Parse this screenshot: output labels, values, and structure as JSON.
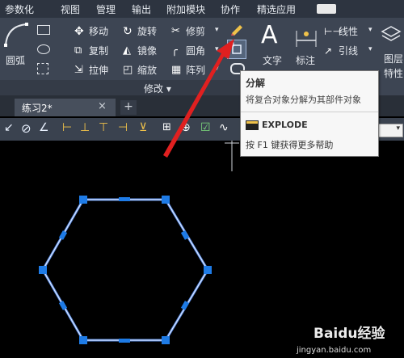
{
  "menu": [
    "参数化",
    "视图",
    "管理",
    "输出",
    "附加模块",
    "协作",
    "精选应用"
  ],
  "ribbon": {
    "arc_label": "圆弧",
    "modify": {
      "move": "移动",
      "rotate": "旋转",
      "trim": "修剪",
      "copy": "复制",
      "mirror": "镜像",
      "fillet": "圆角",
      "stretch": "拉伸",
      "scale": "缩放",
      "array": "阵列",
      "panel_label": "修改 ▾"
    },
    "annotation": {
      "text": "文字",
      "dim": "标注",
      "linear": "线性",
      "leader": "引线"
    },
    "layers_label": "图层",
    "props_label": "特性"
  },
  "tabs": {
    "doc": "练习2*",
    "close": "×",
    "plus": "+"
  },
  "tooltip": {
    "title": "分解",
    "desc": "将复合对象分解为其部件对象",
    "command": "EXPLODE",
    "help": "按 F1 键获得更多帮助"
  },
  "watermark": {
    "brand": "Baidu经验",
    "url": "jingyan.baidu.com"
  },
  "colors": {
    "accent_red": "#e02020",
    "grip_blue": "#1e7be6",
    "hexagon": "#dfe8ff"
  }
}
